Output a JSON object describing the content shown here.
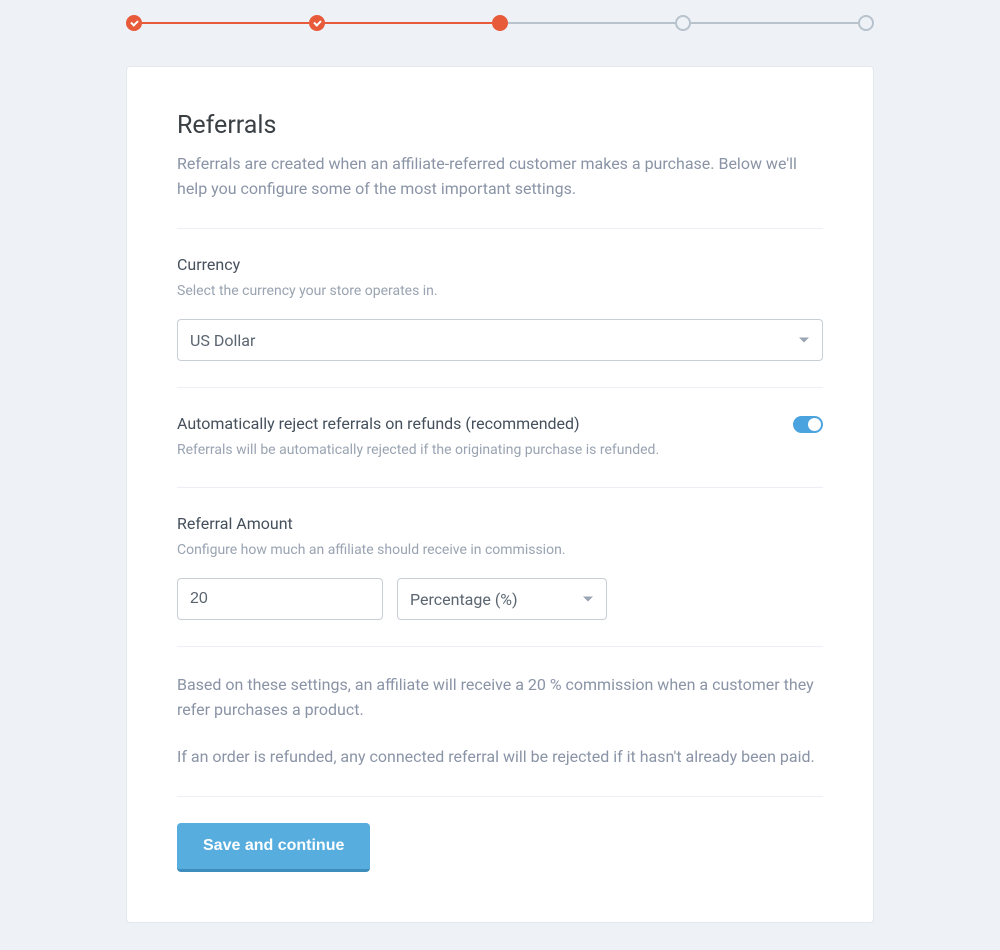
{
  "header": {
    "title": "Referrals",
    "intro": "Referrals are created when an affiliate-referred customer makes a purchase. Below we'll help you configure some of the most important settings."
  },
  "currency": {
    "label": "Currency",
    "hint": "Select the currency your store operates in.",
    "value": "US Dollar"
  },
  "auto_reject": {
    "label": "Automatically reject referrals on refunds (recommended)",
    "hint": "Referrals will be automatically rejected if the originating purchase is refunded.",
    "enabled": true
  },
  "referral_amount": {
    "label": "Referral Amount",
    "hint": "Configure how much an affiliate should receive in commission.",
    "value": "20",
    "type": "Percentage (%)"
  },
  "summary": {
    "line1": "Based on these settings, an affiliate will receive a 20 % commission when a customer they refer purchases a product.",
    "line2": "If an order is refunded, any connected referral will be rejected if it hasn't already been paid."
  },
  "actions": {
    "save": "Save and continue"
  },
  "stepper": {
    "total": 5,
    "current": 3
  }
}
